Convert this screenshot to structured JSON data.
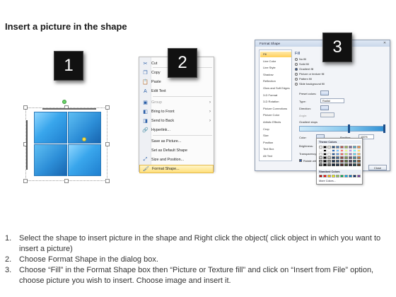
{
  "title": "Insert a picture in the shape",
  "badges": [
    "1",
    "2",
    "3"
  ],
  "context_menu": {
    "items": [
      {
        "label": "Cut",
        "icon": "scissors-icon",
        "icon_glyph": "✂"
      },
      {
        "label": "Copy",
        "icon": "copy-icon",
        "icon_glyph": "❐"
      },
      {
        "label": "Paste",
        "icon": "paste-icon",
        "icon_glyph": "📋"
      },
      {
        "label": "Edit Text",
        "icon": "edit-text-icon",
        "icon_glyph": "A"
      },
      {
        "label": "Group",
        "icon": "group-icon",
        "icon_glyph": "▣",
        "disabled": true,
        "submenu": true
      },
      {
        "label": "Bring to Front",
        "icon": "bring-front-icon",
        "icon_glyph": "◧",
        "submenu": true
      },
      {
        "label": "Send to Back",
        "icon": "send-back-icon",
        "icon_glyph": "◨",
        "submenu": true
      },
      {
        "label": "Hyperlink...",
        "icon": "hyperlink-icon",
        "icon_glyph": "🔗"
      },
      {
        "label": "Save as Picture...",
        "icon": "",
        "icon_glyph": ""
      },
      {
        "label": "Set as Default Shape",
        "icon": "",
        "icon_glyph": ""
      },
      {
        "label": "Size and Position...",
        "icon": "size-icon",
        "icon_glyph": "⤢"
      },
      {
        "label": "Format Shape...",
        "icon": "format-shape-icon",
        "icon_glyph": "🖌"
      }
    ]
  },
  "dialog": {
    "title": "Format Shape",
    "close_glyph": "✕",
    "categories": [
      "Fill",
      "Line Color",
      "Line Style",
      "Shadow",
      "Reflection",
      "Glow and Soft Edges",
      "3-D Format",
      "3-D Rotation",
      "Picture Corrections",
      "Picture Color",
      "Artistic Effects",
      "Crop",
      "Size",
      "Position",
      "Text Box",
      "Alt Text"
    ],
    "fill_heading": "Fill",
    "fill_options": [
      "No fill",
      "Solid fill",
      "Gradient fill",
      "Picture or texture fill",
      "Pattern fill",
      "Slide background fill"
    ],
    "selected_fill": "Gradient fill",
    "preset_colors_label": "Preset colors:",
    "type_label": "Type:",
    "type_value": "Radial",
    "direction_label": "Direction:",
    "angle_label": "Angle:",
    "gradient_stops_label": "Gradient stops",
    "color_label": "Color:",
    "position_label": "Position:",
    "position_value": "100%",
    "brightness_label": "Brightness:",
    "transparency_label": "Transparency:",
    "rotate_label": "Rotate with shape",
    "close_button": "Close"
  },
  "color_popup": {
    "theme_heading": "Theme Colors",
    "standard_heading": "Standard Colors",
    "more_colors": "More Colors...",
    "theme_top": [
      "#ffffff",
      "#000000",
      "#eeece1",
      "#1f497d",
      "#4f81bd",
      "#c0504d",
      "#9bbb59",
      "#8064a2",
      "#4bacc6",
      "#f79646"
    ],
    "standard": [
      "#c00000",
      "#ff0000",
      "#ffc000",
      "#ffff00",
      "#92d050",
      "#00b050",
      "#00b0f0",
      "#0070c0",
      "#002060",
      "#7030a0"
    ]
  },
  "steps": [
    "Select the shape to insert picture in the shape and Right click the object( click object in which you want to insert a picture)",
    "Choose Format Shape in the dialog box.",
    "Choose “Fill” in the Format Shape box then “Picture or Texture fill”  and click on “Insert from File” option, choose picture you wish to insert. Choose image and insert it."
  ],
  "step_numbers": [
    "1.",
    "2.",
    "3."
  ]
}
